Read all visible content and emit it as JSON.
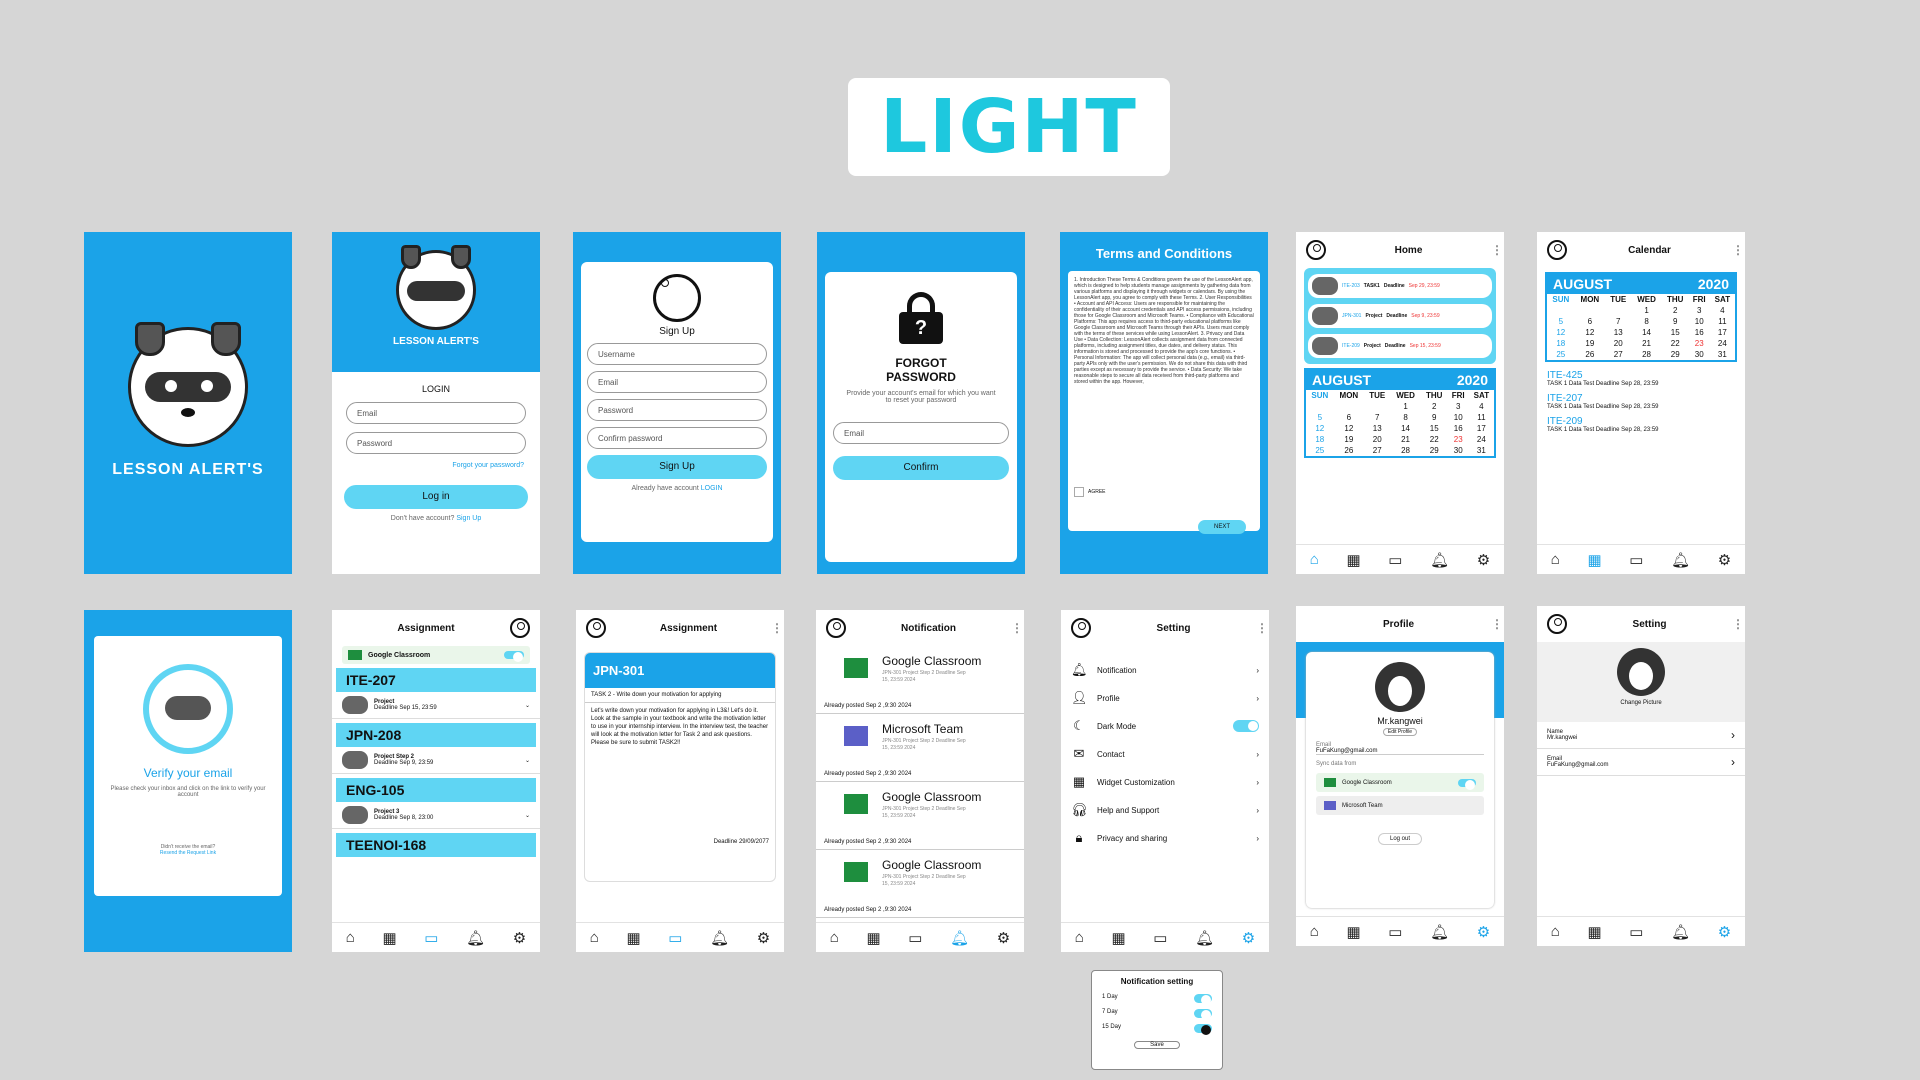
{
  "header": {
    "title": "LIGHT"
  },
  "brand": {
    "name": "LESSON ALERT'S",
    "accent": "#1ba3e8",
    "button_color": "#5fd5f3"
  },
  "login": {
    "title": "LOGIN",
    "email": "Email",
    "password": "Password",
    "forgot": "Forgot your password?",
    "button": "Log in",
    "no_account": "Don't have account?",
    "signup_link": "Sign Up"
  },
  "signup": {
    "title": "Sign Up",
    "username": "Username",
    "email": "Email",
    "password": "Password",
    "confirm": "Confirm password",
    "button": "Sign Up",
    "have_account": "Already have account",
    "login_link": "LOGIN"
  },
  "forgot": {
    "title_1": "FORGOT",
    "title_2": "PASSWORD",
    "desc": "Provide your account's email for which you want to reset your password",
    "email": "Email",
    "button": "Confirm"
  },
  "terms": {
    "title": "Terms and Conditions",
    "body": "1. Introduction These Terms & Conditions govern the use of the LessonAlert app, which is designed to help students manage assignments by gathering data from various platforms and displaying it through widgets or calendars. By using the LessonAlert app, you agree to comply with these Terms. 2. User Responsibilities • Account and API Access: Users are responsible for maintaining the confidentiality of their account credentials and API access permissions, including those for Google Classroom and Microsoft Teams. • Compliance with Educational Platforms: This app requires access to third-party educational platforms like Google Classroom and Microsoft Teams through their APIs. Users must comply with the terms of these services while using LessonAlert. 3. Privacy and Data Use • Data Collection: LessonAlert collects assignment data from connected platforms, including assignment titles, due dates, and delivery status. This information is stored and processed to provide the app's core functions. • Personal Information: The app will collect personal data (e.g., email) via third-party APIs only with the user's permission. We do not share this data with third parties except as necessary to provide the service. • Data Security: We take reasonable steps to secure all data received from third-party platforms and stored within the app. However,",
    "agree": "AGREE",
    "next": "NEXT"
  },
  "home": {
    "title": "Home",
    "tasks": [
      {
        "code": "ITE-203",
        "type": "TASK1",
        "deadline": "Deadline",
        "date": "Sep 29, 23:59"
      },
      {
        "code": "JPN-301",
        "type": "Project",
        "deadline": "Deadline",
        "date": "Sep 9, 23:59"
      },
      {
        "code": "ITE-209",
        "type": "Project",
        "deadline": "Deadline",
        "date": "Sep 15, 23:59"
      }
    ]
  },
  "calendar": {
    "month": "AUGUST",
    "year": "2020",
    "days": [
      "SUN",
      "MON",
      "TUE",
      "WED",
      "THU",
      "FRI",
      "SAT"
    ],
    "weeks": [
      [
        "",
        "",
        "",
        "",
        "",
        "",
        ""
      ],
      [
        "",
        "",
        "",
        "",
        "1",
        "2",
        "3",
        "4"
      ],
      [
        "5",
        "6",
        "7",
        "8",
        "9",
        "10",
        "11"
      ],
      [
        "12",
        "12",
        "13",
        "14",
        "15",
        "16",
        "17"
      ],
      [
        "18",
        "19",
        "20",
        "21",
        "22",
        "23",
        "24"
      ],
      [
        "25",
        "26",
        "27",
        "28",
        "29",
        "30",
        "31"
      ]
    ],
    "title": "Calendar",
    "events": [
      {
        "code": "ITE-425",
        "text": "TASK 1 Data Test Deadline Sep 28, 23:59"
      },
      {
        "code": "ITE-207",
        "text": "TASK 1 Data Test Deadline Sep 28, 23:59"
      },
      {
        "code": "ITE-209",
        "text": "TASK 1 Data Test Deadline Sep 28, 23:59"
      }
    ]
  },
  "verify": {
    "title": "Verify your email",
    "desc": "Please check your inbox and click on the link to verify your account",
    "no_email": "Didn't receive the email?",
    "resend": "Resend the Request Link"
  },
  "assignment": {
    "title": "Assignment",
    "source": "Google Classroom",
    "courses": [
      {
        "code": "ITE-207",
        "proj": "Project",
        "deadline": "Deadline Sep 15, 23:59"
      },
      {
        "code": "JPN-208",
        "proj": "Project Step 2",
        "deadline": "Deadline Sep 9, 23:59"
      },
      {
        "code": "ENG-105",
        "proj": "Project 3",
        "deadline": "Deadline Sep 8, 23:00"
      },
      {
        "code": "TEENOI-168",
        "proj": "",
        "deadline": ""
      }
    ]
  },
  "assignment_detail": {
    "title": "Assignment",
    "code": "JPN-301",
    "task": "TASK 2 - Write down your motivation for applying",
    "body": "Let's write down your motivation for applying in L3&! Let's do it. Look at the sample in your textbook and write the motivation letter to use in your internship interview. In the interview test, the teacher will look at the motivation letter for Task 2 and ask questions. Please be sure to submit TASK2!!",
    "deadline": "Deadline 29/09/2077"
  },
  "notification": {
    "title": "Notification",
    "items": [
      {
        "title": "Google Classroom",
        "detail": "JPN-301 Project Step 2 Deadline Sep 15, 23:59 2024",
        "posted": "Already posted Sep 2 ,9:30 2024"
      },
      {
        "title": "Microsoft Team",
        "detail": "JPN-301 Project Step 2 Deadline Sep 15, 23:59 2024",
        "posted": "Already posted Sep 2 ,9:30 2024"
      },
      {
        "title": "Google Classroom",
        "detail": "JPN-301 Project Step 2 Deadline Sep 15, 23:59 2024",
        "posted": "Already posted Sep 2 ,9:30 2024"
      },
      {
        "title": "Google Classroom",
        "detail": "JPN-301 Project Step 2 Deadline Sep 15, 23:59 2024",
        "posted": "Already posted Sep 2 ,9:30 2024"
      }
    ]
  },
  "setting": {
    "title": "Setting",
    "items": [
      "Notification",
      "Profile",
      "Dark Mode",
      "Contact",
      "Widget Customization",
      "Help and Support",
      "Privacy and sharing"
    ]
  },
  "profile": {
    "title": "Profile",
    "name": "Mr.kangwei",
    "edit": "Edit Profile",
    "email_label": "Email",
    "email": "FuFaKung@gmail.com",
    "sync": "Sync data from",
    "src1": "Google Classroom",
    "src2": "Microsoft Team",
    "logout": "Log out"
  },
  "setting2": {
    "title": "Setting",
    "change": "Change Picture",
    "name_label": "Name",
    "name": "Mr.kangwei",
    "email_label": "Email",
    "email": "FuFaKung@gmail.com"
  },
  "notif_setting": {
    "title": "Notification setting",
    "opts": [
      "1 Day",
      "7 Day",
      "15 Day"
    ],
    "save": "Save"
  }
}
